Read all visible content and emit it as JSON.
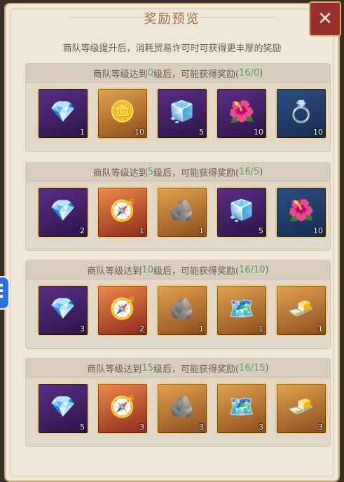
{
  "title": "奖励预览",
  "subtitle": "商队等级提升后，消耗贸易许可时可获得更丰厚的奖励",
  "close_icon": "close-icon",
  "sections": [
    {
      "label_prefix": "商队等级达到",
      "level": "0",
      "label_suffix": "级后，可能获得奖励(",
      "count": "16/0",
      "label_end": ")",
      "items": [
        {
          "name": "crystal-pile-on-cushion",
          "quality": "purple",
          "count": "1",
          "glyph": "💎"
        },
        {
          "name": "gold-ingot-on-cushion",
          "quality": "gold",
          "count": "10",
          "glyph": "🪙"
        },
        {
          "name": "silver-bar",
          "quality": "purple",
          "count": "5",
          "glyph": "🧊"
        },
        {
          "name": "flower-wreath",
          "quality": "purple",
          "count": "10",
          "glyph": "🌺"
        },
        {
          "name": "gold-ring",
          "quality": "blue",
          "count": "10",
          "glyph": "💍"
        }
      ]
    },
    {
      "label_prefix": "商队等级达到",
      "level": "5",
      "label_suffix": "级后，可能获得奖励(",
      "count": "16/5",
      "label_end": ")",
      "items": [
        {
          "name": "crystal-pile-on-cushion",
          "quality": "purple",
          "count": "2",
          "glyph": "💎"
        },
        {
          "name": "compass-orb",
          "quality": "red",
          "count": "1",
          "glyph": "🧭"
        },
        {
          "name": "stone-tablet",
          "quality": "gold",
          "count": "1",
          "glyph": "🪨"
        },
        {
          "name": "silver-bar",
          "quality": "purple",
          "count": "5",
          "glyph": "🧊"
        },
        {
          "name": "flower-wreath",
          "quality": "blue",
          "count": "10",
          "glyph": "🌺"
        }
      ]
    },
    {
      "label_prefix": "商队等级达到",
      "level": "10",
      "label_suffix": "级后，可能获得奖励(",
      "count": "16/10",
      "label_end": ")",
      "items": [
        {
          "name": "crystal-pile-on-cushion",
          "quality": "purple",
          "count": "3",
          "glyph": "💎"
        },
        {
          "name": "compass-orb",
          "quality": "red",
          "count": "2",
          "glyph": "🧭"
        },
        {
          "name": "stone-tablet",
          "quality": "gold",
          "count": "1",
          "glyph": "🪨"
        },
        {
          "name": "map-scroll",
          "quality": "gold",
          "count": "1",
          "glyph": "🗺️"
        },
        {
          "name": "gold-bar",
          "quality": "gold",
          "count": "1",
          "glyph": "🧈"
        }
      ]
    },
    {
      "label_prefix": "商队等级达到",
      "level": "15",
      "label_suffix": "级后，可能获得奖励(",
      "count": "16/15",
      "label_end": ")",
      "items": [
        {
          "name": "crystal-pile-on-cushion",
          "quality": "purple",
          "count": "5",
          "glyph": "💎"
        },
        {
          "name": "compass-orb",
          "quality": "red",
          "count": "3",
          "glyph": "🧭"
        },
        {
          "name": "stone-tablet",
          "quality": "gold",
          "count": "3",
          "glyph": "🪨"
        },
        {
          "name": "map-scroll",
          "quality": "gold",
          "count": "3",
          "glyph": "🗺️"
        },
        {
          "name": "gold-bar",
          "quality": "gold",
          "count": "3",
          "glyph": "🧈"
        }
      ]
    }
  ],
  "colors": {
    "title": "#a26a43",
    "level_green": "#4ea356",
    "close_bg": "#9a2f2b"
  }
}
